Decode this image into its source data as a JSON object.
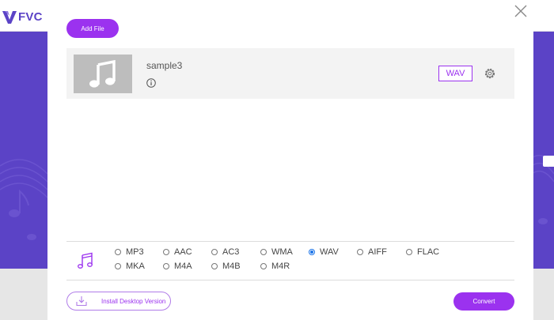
{
  "app": {
    "logo_text": "FVC"
  },
  "toolbar": {
    "add_file_label": "Add File"
  },
  "file": {
    "name": "sample3",
    "output_format": "WAV"
  },
  "formats": {
    "options": [
      "MP3",
      "AAC",
      "AC3",
      "WMA",
      "WAV",
      "AIFF",
      "FLAC",
      "MKA",
      "M4A",
      "M4B",
      "M4R"
    ],
    "selected": "WAV"
  },
  "footer": {
    "install_label": "Install Desktop Version",
    "convert_label": "Convert"
  },
  "colors": {
    "accent": "#9b32ef",
    "band": "#5b43c6",
    "radio_selected": "#1a73e8"
  },
  "icons": {
    "logo": "fvc-logo-icon",
    "close": "close-icon",
    "thumbnail": "music-note-icon",
    "info": "info-icon",
    "settings": "gear-icon",
    "audio": "music-note-icon",
    "install": "download-icon"
  }
}
